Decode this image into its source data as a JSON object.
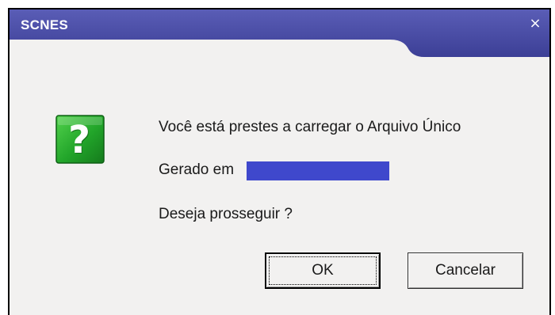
{
  "window": {
    "title": "SCNES",
    "close_glyph": "×",
    "titlebar_color": "#44479f",
    "body_color": "#f2f1f0"
  },
  "dialog": {
    "icon": "question-icon",
    "icon_glyph": "?",
    "icon_color": "#22a52a",
    "message_line1": "Você está prestes a carregar o Arquivo Único",
    "message_line2_prefix": "Gerado em",
    "redaction_color": "#3f48cc",
    "message_line3": "Deseja prosseguir ?"
  },
  "buttons": {
    "ok_label": "OK",
    "cancel_label": "Cancelar"
  }
}
